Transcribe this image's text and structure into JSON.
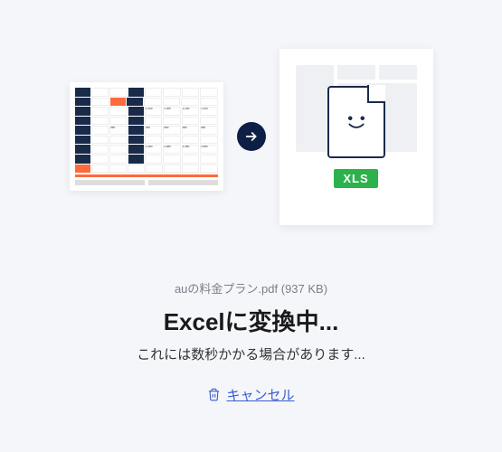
{
  "file": {
    "name": "auの料金プラン.pdf",
    "size_label": "(937 KB)"
  },
  "status": {
    "title": "Excelに変換中...",
    "subtitle": "これには数秒かかる場合があります..."
  },
  "target": {
    "badge": "XLS"
  },
  "actions": {
    "cancel_label": "キャンセル"
  }
}
